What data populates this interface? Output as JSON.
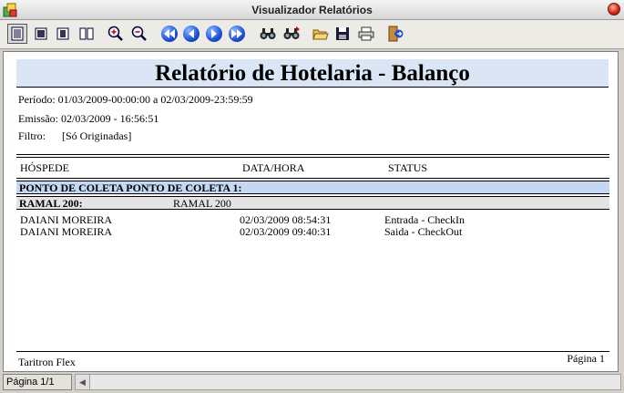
{
  "window": {
    "title": "Visualizador Relatórios"
  },
  "toolbar": {
    "buttons": [
      {
        "icon": "page-view-icon"
      },
      {
        "icon": "fit-page-icon"
      },
      {
        "icon": "page-width-icon"
      },
      {
        "icon": "two-pages-icon"
      },
      {
        "icon": "zoom-in-icon"
      },
      {
        "icon": "zoom-out-icon"
      },
      {
        "icon": "first-page-icon"
      },
      {
        "icon": "previous-page-icon"
      },
      {
        "icon": "next-page-icon"
      },
      {
        "icon": "last-page-icon"
      },
      {
        "icon": "find-icon"
      },
      {
        "icon": "find-next-icon"
      },
      {
        "icon": "open-icon"
      },
      {
        "icon": "save-icon"
      },
      {
        "icon": "print-icon"
      },
      {
        "icon": "exit-icon"
      }
    ]
  },
  "report": {
    "title": "Relatório de Hotelaria - Balanço",
    "periodo": "Período:  01/03/2009-00:00:00 a 02/03/2009-23:59:59",
    "emissao": "Emissão: 02/03/2009 - 16:56:51",
    "filtro_label": "Filtro:",
    "filtro_value": "[Só Originadas]",
    "columns": [
      "HÓSPEDE",
      "DATA/HORA",
      "STATUS"
    ],
    "group1": "PONTO DE COLETA   PONTO DE COLETA 1:",
    "group2_label": "RAMAL   200:",
    "group2_value": "RAMAL 200",
    "rows": [
      {
        "hospede": "DAIANI MOREIRA",
        "datahora": "02/03/2009 08:54:31",
        "status": "Entrada - CheckIn"
      },
      {
        "hospede": "DAIANI MOREIRA",
        "datahora": "02/03/2009 09:40:31",
        "status": "Saida - CheckOut"
      }
    ],
    "footer_left": "Taritron Flex",
    "footer_right": "Página 1"
  },
  "statusbar": {
    "page": "Página 1/1"
  },
  "colors": {
    "title_band": "#dae6f5",
    "group_band": "#c5d8f3",
    "ramal_band": "#e4e4e4"
  }
}
